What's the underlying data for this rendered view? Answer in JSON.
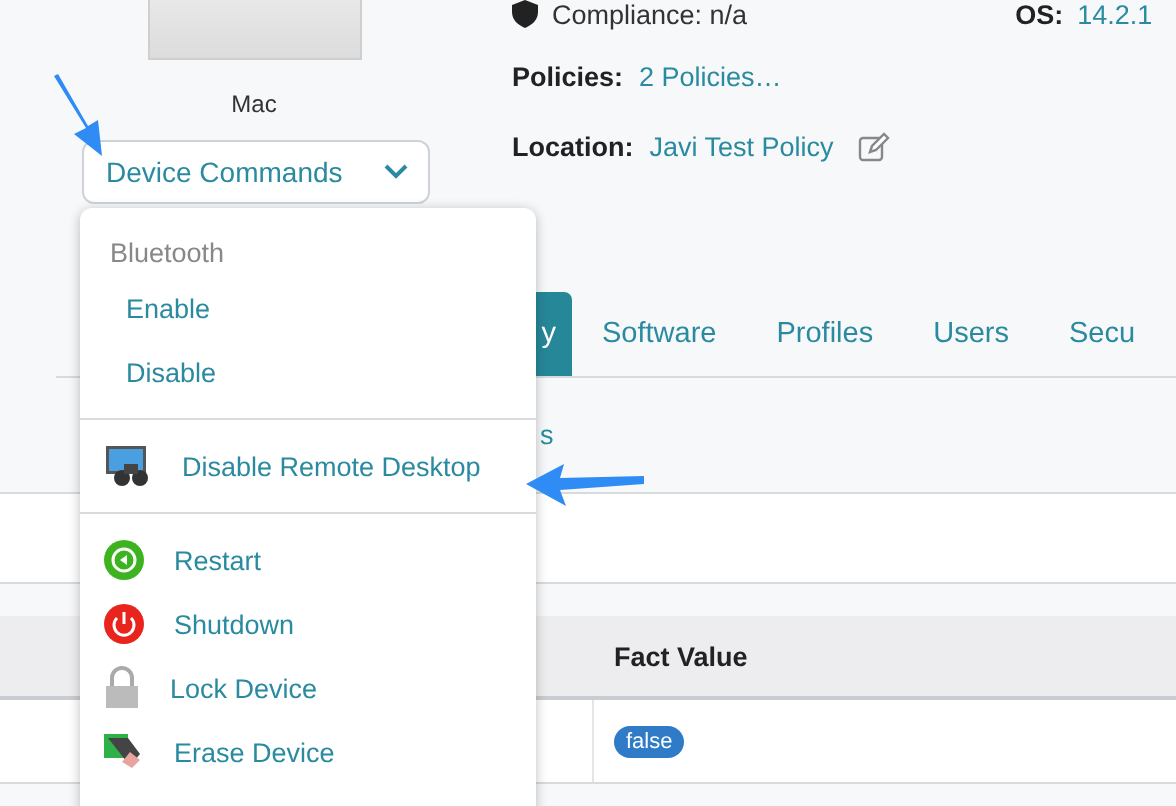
{
  "device": {
    "label": "Mac"
  },
  "commands_button": {
    "label": "Device Commands",
    "expanded": true
  },
  "info": {
    "compliance": "Compliance: n/a",
    "os_label": "OS:",
    "os_value": "14.2.1",
    "policies_label": "Policies:",
    "policies_value": "2 Policies…",
    "location_label": "Location:",
    "location_value": "Javi Test Policy"
  },
  "tabs": [
    {
      "label": "y",
      "selected": true
    },
    {
      "label": "Software",
      "selected": false
    },
    {
      "label": "Profiles",
      "selected": false
    },
    {
      "label": "Users",
      "selected": false
    },
    {
      "label": "Secu",
      "selected": false
    }
  ],
  "subtabs": [
    {
      "label": "s"
    }
  ],
  "table": {
    "columns": [
      "Fact Value"
    ],
    "rows": [
      {
        "fact_value": "false"
      }
    ]
  },
  "menu": {
    "items": [
      {
        "kind": "header",
        "label": "Bluetooth"
      },
      {
        "kind": "action",
        "label": "Enable"
      },
      {
        "kind": "action",
        "label": "Disable"
      },
      {
        "kind": "divider"
      },
      {
        "kind": "icon_action",
        "label": "Disable Remote Desktop"
      },
      {
        "kind": "divider"
      },
      {
        "kind": "icon_action",
        "label": "Restart"
      },
      {
        "kind": "icon_action",
        "label": "Shutdown"
      },
      {
        "kind": "icon_action",
        "label": "Lock Device"
      },
      {
        "kind": "icon_action",
        "label": "Erase Device"
      }
    ]
  }
}
